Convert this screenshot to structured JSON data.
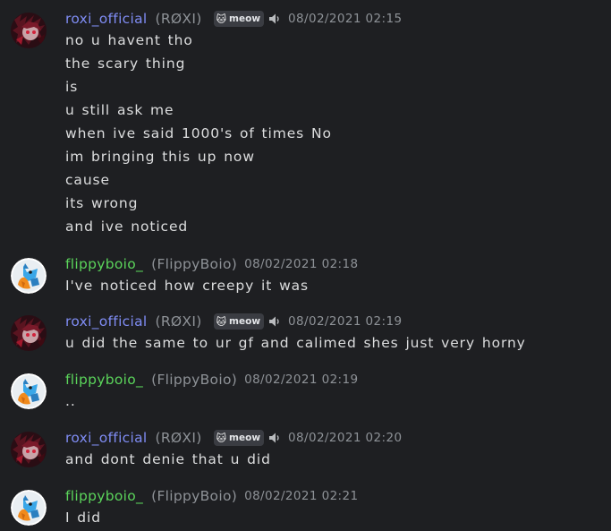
{
  "messages": [
    {
      "author": "roxi_official",
      "alias": "(RØXI)",
      "badge": "meow",
      "timestamp": "08/02/2021  02:15",
      "lines": [
        "no u havent tho",
        "the scary thing",
        "is",
        "u still ask me",
        "when ive said 1000's of times No",
        "im bringing this up now",
        "cause",
        "its wrong",
        "and ive noticed"
      ]
    },
    {
      "author": "flippyboio_",
      "alias": "(FlippyBoio)",
      "timestamp": "08/02/2021  02:18",
      "lines": [
        "I've noticed how creepy it was"
      ]
    },
    {
      "author": "roxi_official",
      "alias": "(RØXI)",
      "badge": "meow",
      "timestamp": "08/02/2021  02:19",
      "lines": [
        "u did the same to ur gf and calimed shes just very horny"
      ]
    },
    {
      "author": "flippyboio_",
      "alias": "(FlippyBoio)",
      "timestamp": "08/02/2021  02:19",
      "lines": [
        ".."
      ]
    },
    {
      "author": "roxi_official",
      "alias": "(RØXI)",
      "badge": "meow",
      "timestamp": "08/02/2021  02:20",
      "lines": [
        "and dont denie that u did"
      ]
    },
    {
      "author": "flippyboio_",
      "alias": "(FlippyBoio)",
      "timestamp": "08/02/2021  02:21",
      "lines": [
        "I did"
      ]
    }
  ],
  "icons": {
    "badge": "cat-icon",
    "speaker": "speaker-icon",
    "roxi_avatar": "red-anime-character-avatar",
    "flippy_avatar": "blue-fox-character-avatar"
  },
  "colors": {
    "background": "#1e1f22",
    "roxi_name": "#7f8cf3",
    "flippy_name": "#5bd45b",
    "muted": "#8e9297",
    "text": "#dcddde"
  }
}
